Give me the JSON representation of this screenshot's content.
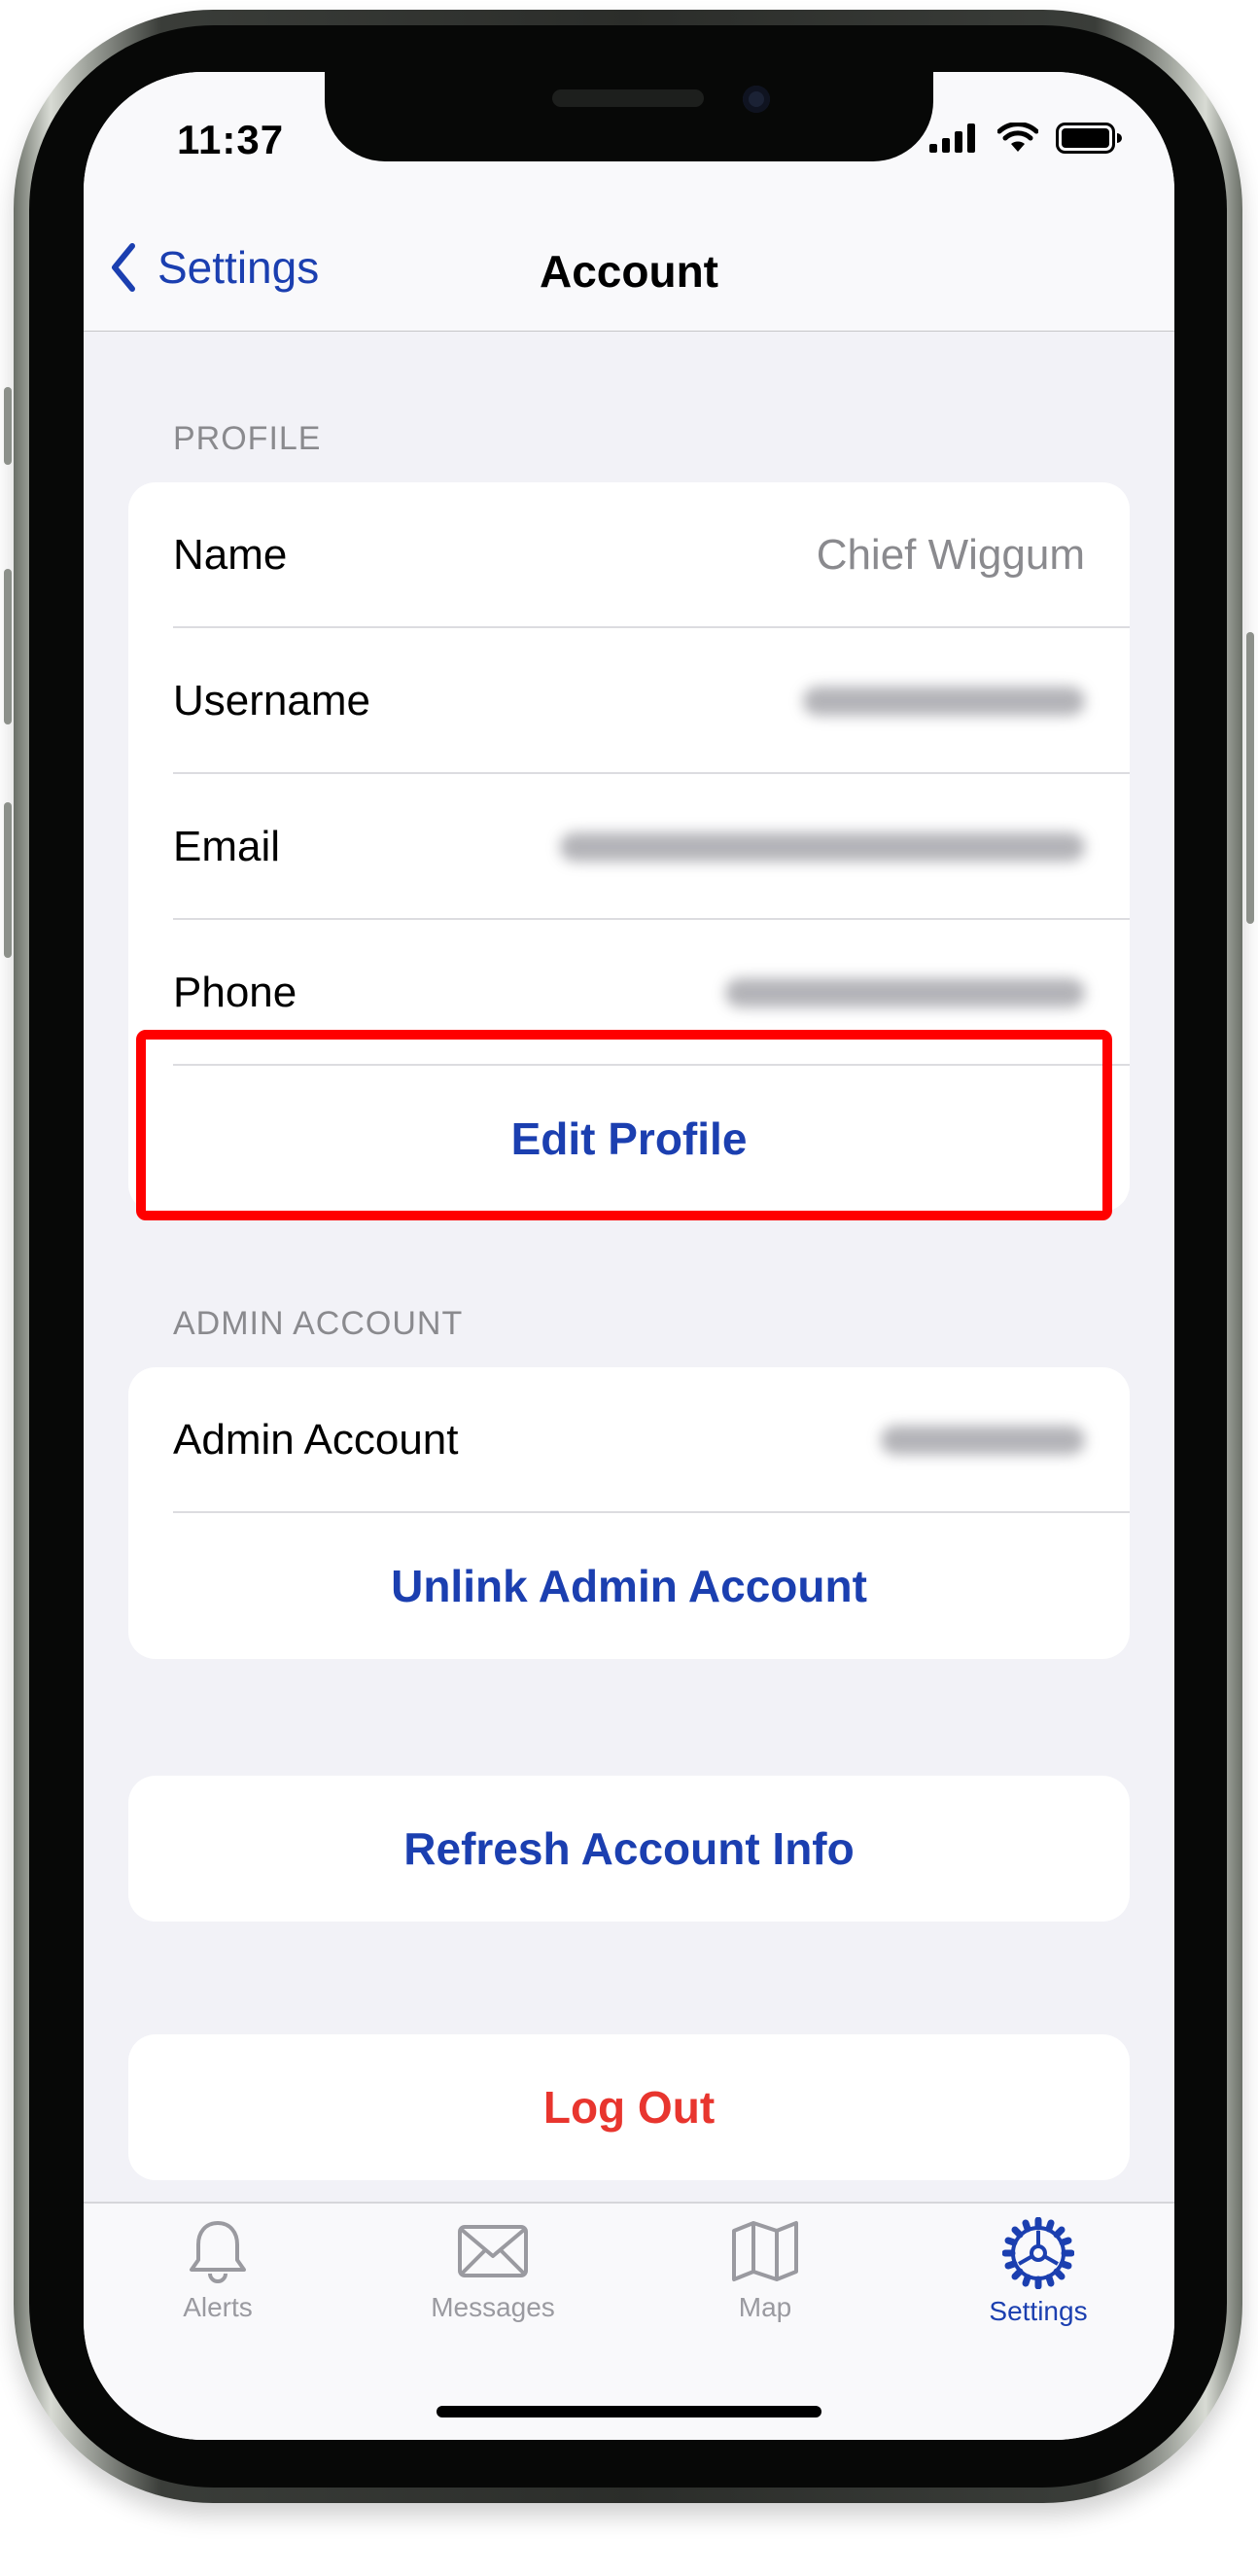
{
  "status_bar": {
    "time": "11:37"
  },
  "nav": {
    "back_label": "Settings",
    "title": "Account"
  },
  "profile": {
    "header": "PROFILE",
    "rows": [
      {
        "label": "Name",
        "value": "Chief Wiggum"
      },
      {
        "label": "Username",
        "value": ""
      },
      {
        "label": "Email",
        "value": ""
      },
      {
        "label": "Phone",
        "value": ""
      }
    ],
    "edit_button": "Edit Profile"
  },
  "admin": {
    "header": "ADMIN ACCOUNT",
    "row_label": "Admin Account",
    "unlink_button": "Unlink Admin Account"
  },
  "refresh_button": "Refresh Account Info",
  "logout_button": "Log Out",
  "tabs": [
    {
      "label": "Alerts",
      "icon": "bell-icon"
    },
    {
      "label": "Messages",
      "icon": "envelope-icon"
    },
    {
      "label": "Map",
      "icon": "map-icon"
    },
    {
      "label": "Settings",
      "icon": "gear-icon",
      "active": true
    }
  ],
  "colors": {
    "accent": "#1b3fb0",
    "destructive": "#e8352e",
    "highlight": "#ff0000",
    "background": "#f2f2f7"
  }
}
